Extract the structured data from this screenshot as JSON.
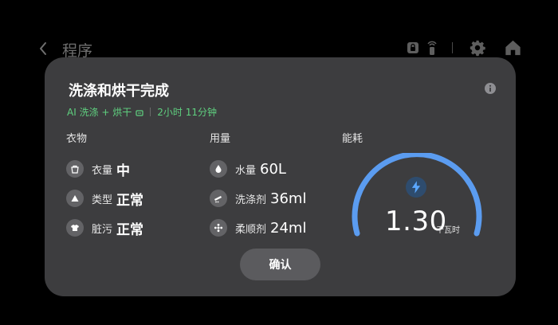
{
  "app": {
    "title": "程序",
    "header_icons": [
      "lock-icon",
      "remote-icon",
      "gear-icon",
      "home-icon"
    ]
  },
  "dialog": {
    "title": "洗涤和烘干完成",
    "subtitle": {
      "program": "AI 洗涤 + 烘干",
      "duration": "2小时 11分钟"
    },
    "sections": {
      "clothes": {
        "heading": "衣物",
        "items": [
          {
            "icon": "load-icon",
            "label": "衣量",
            "value": "中"
          },
          {
            "icon": "fabric-icon",
            "label": "类型",
            "value": "正常"
          },
          {
            "icon": "soil-icon",
            "label": "脏污",
            "value": "正常"
          }
        ]
      },
      "usage": {
        "heading": "用量",
        "items": [
          {
            "icon": "water-drop-icon",
            "label": "水量",
            "value": "60L"
          },
          {
            "icon": "detergent-icon",
            "label": "洗涤剂",
            "value": "36ml"
          },
          {
            "icon": "softener-icon",
            "label": "柔顺剂",
            "value": "24ml"
          }
        ]
      },
      "energy": {
        "heading": "能耗",
        "value": "1.30",
        "unit": "千瓦时",
        "gauge_fill": 1.0,
        "gauge_color": "#5b9cf0"
      }
    },
    "confirm_label": "确认"
  },
  "colors": {
    "background": "#000000",
    "dialog": "#3d3d3f",
    "accent_green": "#5fd07f",
    "gauge_blue": "#5b9cf0"
  }
}
